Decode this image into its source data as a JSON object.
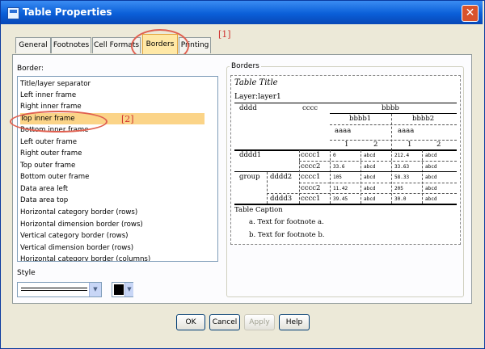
{
  "window": {
    "title": "Table Properties"
  },
  "tabs": [
    {
      "label": "General",
      "active": false
    },
    {
      "label": "Footnotes",
      "active": false
    },
    {
      "label": "Cell Formats",
      "active": false
    },
    {
      "label": "Borders",
      "active": true
    },
    {
      "label": "Printing",
      "active": false
    }
  ],
  "annotations": {
    "a1": "[1]",
    "a2": "[2]"
  },
  "border_list": {
    "label": "Border:",
    "items": [
      "Title/layer separator",
      "Left inner frame",
      "Right inner frame",
      "Top inner frame",
      "Bottom inner frame",
      "Left outer frame",
      "Right outer frame",
      "Top outer frame",
      "Bottom outer frame",
      "Data area left",
      "Data area top",
      "Horizontal category border (rows)",
      "Horizontal dimension border (rows)",
      "Vertical category border (rows)",
      "Vertical dimension border (rows)",
      "Horizontal category border (columns)"
    ],
    "selected": "Top inner frame"
  },
  "style": {
    "label": "Style",
    "color": "#000000"
  },
  "preview": {
    "group_label": "Borders",
    "title": "Table Title",
    "layer": "Layer:layer1",
    "col_headers": {
      "dddd": "dddd",
      "cccc": "cccc",
      "bbbb": "bbbb",
      "bbbb1": "bbbb1",
      "bbbb2": "bbbb2",
      "aaaa": "aaaa",
      "one": "1",
      "two": "2"
    },
    "rows": [
      {
        "g": "dddd1",
        "c": "cccc1",
        "v1": "0",
        "v2": "abcd",
        "v3": "212.4",
        "v4": "abcd"
      },
      {
        "g": "",
        "c": "cccc2",
        "v1": "33.6",
        "v2": "abcd",
        "v3": "33.63",
        "v4": "abcd"
      },
      {
        "g": "group",
        "sub": "dddd2",
        "c": "cccc1",
        "v1": "105",
        "v2": "abcd",
        "v3": "58.33",
        "v4": "abcd"
      },
      {
        "g": "",
        "c": "cccc2",
        "v1": "11.42",
        "v2": "abcd",
        "v3": "205",
        "v4": "abcd"
      },
      {
        "g": "",
        "sub": "dddd3",
        "c": "cccc1",
        "v1": "39.45",
        "v2": "abcd",
        "v3": "30.0",
        "v4": "abcd"
      }
    ],
    "caption": "Table Caption",
    "footnote_a": "a. Text for footnote a.",
    "footnote_b": "b. Text for footnote b."
  },
  "buttons": {
    "ok": "OK",
    "cancel": "Cancel",
    "apply": "Apply",
    "help": "Help"
  }
}
